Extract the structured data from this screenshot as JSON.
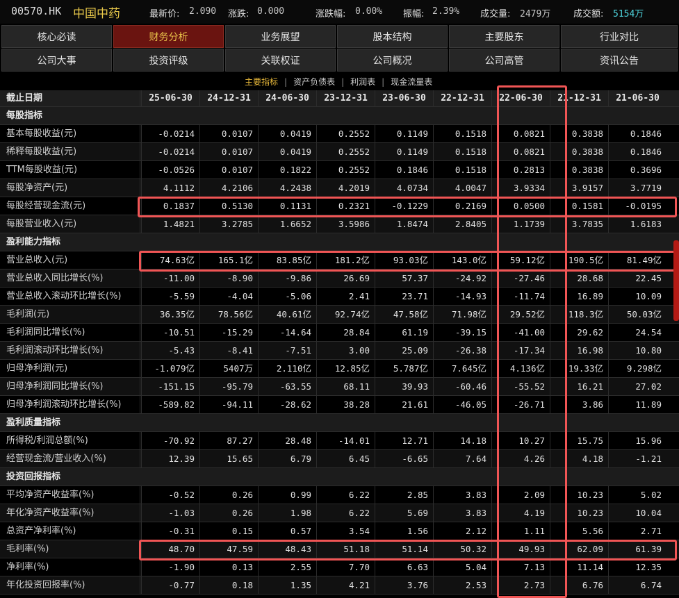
{
  "header": {
    "code": "00570.HK",
    "name": "中国中药",
    "latest_label": "最新价:",
    "latest_value": "2.090",
    "change_label": "涨跌:",
    "change_value": "0.000",
    "change_pct_label": "涨跌幅:",
    "change_pct_value": "0.00%",
    "amplitude_label": "振幅:",
    "amplitude_value": "2.39%",
    "volume_label": "成交量:",
    "volume_value": "2479万",
    "turnover_label": "成交额:",
    "turnover_value": "5154万"
  },
  "nav": {
    "row1": [
      "核心必读",
      "财务分析",
      "业务展望",
      "股本结构",
      "主要股东",
      "行业对比"
    ],
    "row2": [
      "公司大事",
      "投资评级",
      "关联权证",
      "公司概况",
      "公司高管",
      "资讯公告"
    ],
    "active": "财务分析"
  },
  "subtabs": {
    "items": [
      "主要指标",
      "资产负债表",
      "利润表",
      "现金流量表"
    ],
    "active": "主要指标",
    "separator": "|"
  },
  "table": {
    "header_label": "截止日期",
    "dates": [
      "25-06-30",
      "24-12-31",
      "24-06-30",
      "23-12-31",
      "23-06-30",
      "22-12-31",
      "22-06-30",
      "21-12-31",
      "21-06-30"
    ],
    "rows": [
      {
        "type": "section",
        "name": "每股指标"
      },
      {
        "type": "data",
        "name": "基本每股收益(元)",
        "values": [
          "-0.0214",
          "0.0107",
          "0.0419",
          "0.2552",
          "0.1149",
          "0.1518",
          "0.0821",
          "0.3838",
          "0.1846"
        ]
      },
      {
        "type": "data",
        "name": "稀释每股收益(元)",
        "values": [
          "-0.0214",
          "0.0107",
          "0.0419",
          "0.2552",
          "0.1149",
          "0.1518",
          "0.0821",
          "0.3838",
          "0.1846"
        ]
      },
      {
        "type": "data",
        "name": "TTM每股收益(元)",
        "values": [
          "-0.0526",
          "0.0107",
          "0.1822",
          "0.2552",
          "0.1846",
          "0.1518",
          "0.2813",
          "0.3838",
          "0.3696"
        ]
      },
      {
        "type": "data",
        "name": "每股净资产(元)",
        "values": [
          "4.1112",
          "4.2106",
          "4.2438",
          "4.2019",
          "4.0734",
          "4.0047",
          "3.9334",
          "3.9157",
          "3.7719"
        ]
      },
      {
        "type": "data",
        "name": "每股经营现金流(元)",
        "values": [
          "0.1837",
          "0.5130",
          "0.1131",
          "0.2321",
          "-0.1229",
          "0.2169",
          "0.0500",
          "0.1581",
          "-0.0195"
        ]
      },
      {
        "type": "data",
        "name": "每股营业收入(元)",
        "values": [
          "1.4821",
          "3.2785",
          "1.6652",
          "3.5986",
          "1.8474",
          "2.8405",
          "1.1739",
          "3.7835",
          "1.6183"
        ]
      },
      {
        "type": "section",
        "name": "盈利能力指标"
      },
      {
        "type": "data",
        "name": "营业总收入(元)",
        "values": [
          "74.63亿",
          "165.1亿",
          "83.85亿",
          "181.2亿",
          "93.03亿",
          "143.0亿",
          "59.12亿",
          "190.5亿",
          "81.49亿"
        ]
      },
      {
        "type": "data",
        "name": "营业总收入同比增长(%)",
        "values": [
          "-11.00",
          "-8.90",
          "-9.86",
          "26.69",
          "57.37",
          "-24.92",
          "-27.46",
          "28.68",
          "22.45"
        ]
      },
      {
        "type": "data",
        "name": "营业总收入滚动环比增长(%)",
        "values": [
          "-5.59",
          "-4.04",
          "-5.06",
          "2.41",
          "23.71",
          "-14.93",
          "-11.74",
          "16.89",
          "10.09"
        ]
      },
      {
        "type": "data",
        "name": "毛利润(元)",
        "values": [
          "36.35亿",
          "78.56亿",
          "40.61亿",
          "92.74亿",
          "47.58亿",
          "71.98亿",
          "29.52亿",
          "118.3亿",
          "50.03亿"
        ]
      },
      {
        "type": "data",
        "name": "毛利润同比增长(%)",
        "values": [
          "-10.51",
          "-15.29",
          "-14.64",
          "28.84",
          "61.19",
          "-39.15",
          "-41.00",
          "29.62",
          "24.54"
        ]
      },
      {
        "type": "data",
        "name": "毛利润滚动环比增长(%)",
        "values": [
          "-5.43",
          "-8.41",
          "-7.51",
          "3.00",
          "25.09",
          "-26.38",
          "-17.34",
          "16.98",
          "10.80"
        ]
      },
      {
        "type": "data",
        "name": "归母净利润(元)",
        "values": [
          "-1.079亿",
          "5407万",
          "2.110亿",
          "12.85亿",
          "5.787亿",
          "7.645亿",
          "4.136亿",
          "19.33亿",
          "9.298亿"
        ]
      },
      {
        "type": "data",
        "name": "归母净利润同比增长(%)",
        "values": [
          "-151.15",
          "-95.79",
          "-63.55",
          "68.11",
          "39.93",
          "-60.46",
          "-55.52",
          "16.21",
          "27.02"
        ]
      },
      {
        "type": "data",
        "name": "归母净利润滚动环比增长(%)",
        "values": [
          "-589.82",
          "-94.11",
          "-28.62",
          "38.28",
          "21.61",
          "-46.05",
          "-26.71",
          "3.86",
          "11.89"
        ]
      },
      {
        "type": "section",
        "name": "盈利质量指标"
      },
      {
        "type": "data",
        "name": "所得税/利润总额(%)",
        "values": [
          "-70.92",
          "87.27",
          "28.48",
          "-14.01",
          "12.71",
          "14.18",
          "10.27",
          "15.75",
          "15.96"
        ]
      },
      {
        "type": "data",
        "name": "经营现金流/营业收入(%)",
        "values": [
          "12.39",
          "15.65",
          "6.79",
          "6.45",
          "-6.65",
          "7.64",
          "4.26",
          "4.18",
          "-1.21"
        ]
      },
      {
        "type": "section",
        "name": "投资回报指标"
      },
      {
        "type": "data",
        "name": "平均净资产收益率(%)",
        "values": [
          "-0.52",
          "0.26",
          "0.99",
          "6.22",
          "2.85",
          "3.83",
          "2.09",
          "10.23",
          "5.02"
        ]
      },
      {
        "type": "data",
        "name": "年化净资产收益率(%)",
        "values": [
          "-1.03",
          "0.26",
          "1.98",
          "6.22",
          "5.69",
          "3.83",
          "4.19",
          "10.23",
          "10.04"
        ]
      },
      {
        "type": "data",
        "name": "总资产净利率(%)",
        "values": [
          "-0.31",
          "0.15",
          "0.57",
          "3.54",
          "1.56",
          "2.12",
          "1.11",
          "5.56",
          "2.71"
        ]
      },
      {
        "type": "data",
        "name": "毛利率(%)",
        "values": [
          "48.70",
          "47.59",
          "48.43",
          "51.18",
          "51.14",
          "50.32",
          "49.93",
          "62.09",
          "61.39"
        ]
      },
      {
        "type": "data",
        "name": "净利率(%)",
        "values": [
          "-1.90",
          "0.13",
          "2.55",
          "7.70",
          "6.63",
          "5.04",
          "7.13",
          "11.14",
          "12.35"
        ]
      },
      {
        "type": "data",
        "name": "年化投资回报率(%)",
        "values": [
          "-0.77",
          "0.18",
          "1.35",
          "4.21",
          "3.76",
          "2.53",
          "2.73",
          "6.76",
          "6.74"
        ]
      }
    ]
  },
  "highlights": {
    "rows": [
      "每股经营现金流(元)",
      "营业总收入(元)",
      "毛利率(%)"
    ],
    "column": "22-06-30",
    "color": "#f05555"
  },
  "scrollbar": {
    "color": "#b41a14"
  }
}
